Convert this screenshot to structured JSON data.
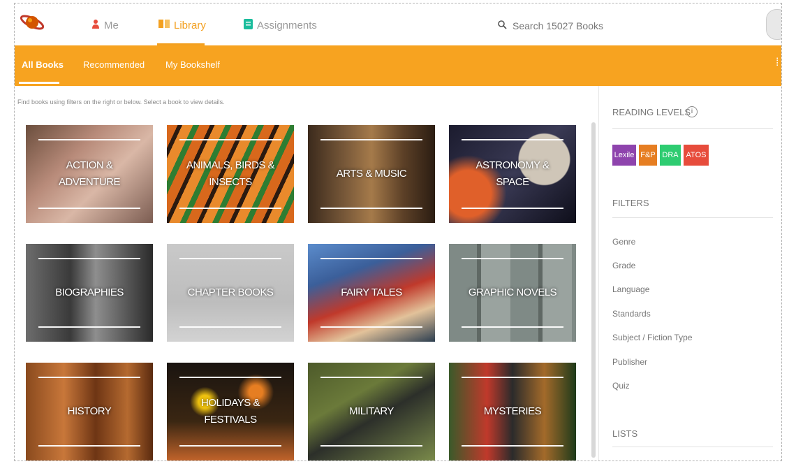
{
  "header": {
    "nav": [
      {
        "label": "Me",
        "icon": "person-icon"
      },
      {
        "label": "Library",
        "icon": "book-icon"
      },
      {
        "label": "Assignments",
        "icon": "clipboard-icon"
      }
    ],
    "search_placeholder": "Search 15027 Books",
    "accent": "#f7a320"
  },
  "subnav": {
    "tabs": [
      "All Books",
      "Recommended",
      "My Bookshelf"
    ]
  },
  "hint": "Find books using filters on the right or below. Select a book to view details.",
  "categories": [
    {
      "label": "Action & Adventure"
    },
    {
      "label": "Animals, Birds & Insects"
    },
    {
      "label": "Arts & Music"
    },
    {
      "label": "Astronomy & Space"
    },
    {
      "label": "Biographies"
    },
    {
      "label": "Chapter Books"
    },
    {
      "label": "Fairy Tales"
    },
    {
      "label": "Graphic Novels"
    },
    {
      "label": "History"
    },
    {
      "label": "Holidays & Festivals"
    },
    {
      "label": "Military"
    },
    {
      "label": "Mysteries"
    }
  ],
  "sidebar": {
    "reading_levels_title": "READING LEVELS",
    "levels": [
      {
        "label": "Lexile",
        "color": "#8e44ad"
      },
      {
        "label": "F&P",
        "color": "#e67e22"
      },
      {
        "label": "DRA",
        "color": "#2ecc71"
      },
      {
        "label": "ATOS",
        "color": "#e74c3c"
      }
    ],
    "filters_title": "FILTERS",
    "filters": [
      "Genre",
      "Grade",
      "Language",
      "Standards",
      "Subject / Fiction Type",
      "Publisher",
      "Quiz"
    ],
    "lists_title": "LISTS"
  }
}
